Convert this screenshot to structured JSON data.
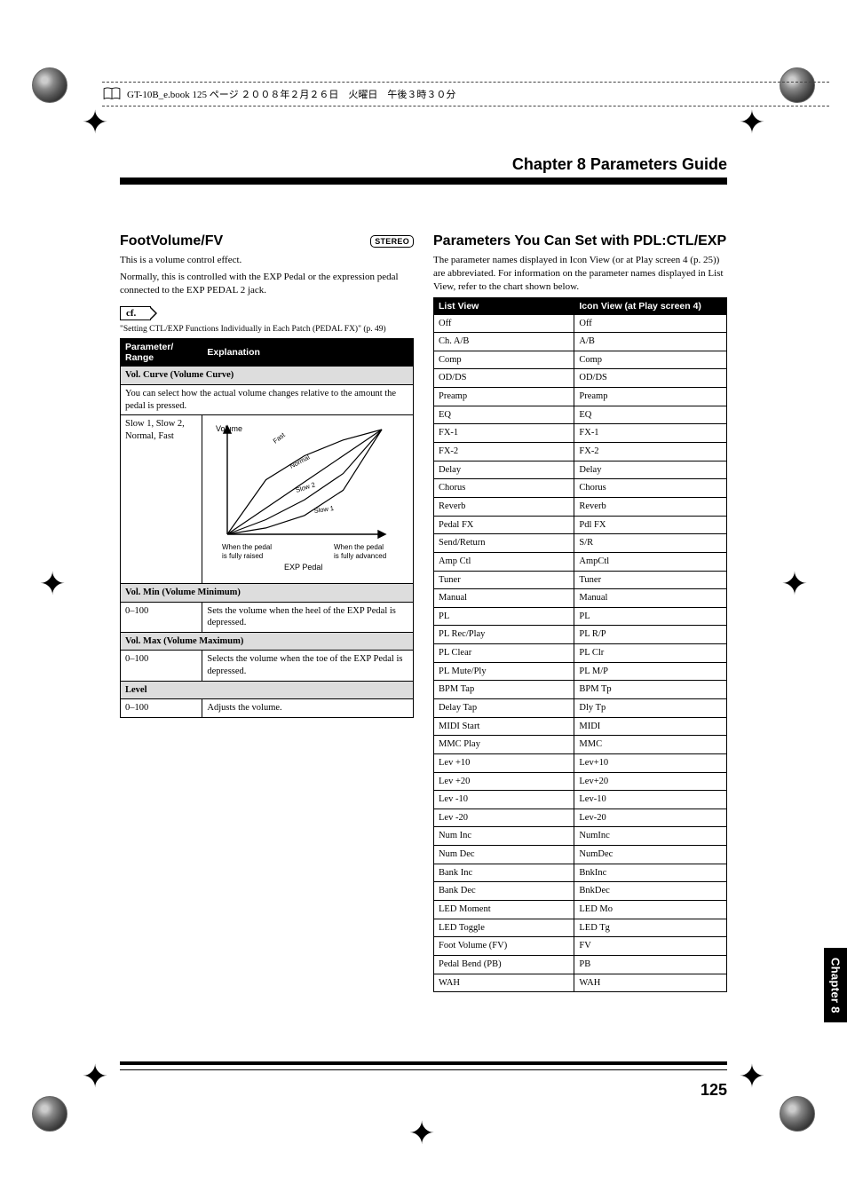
{
  "header_strip": "GT-10B_e.book 125 ページ ２００８年２月２６日　火曜日　午後３時３０分",
  "chapter_title": "Chapter 8 Parameters Guide",
  "side_tab": "Chapter 8",
  "page_number": "125",
  "left": {
    "heading": "FootVolume/FV",
    "stereo": "STEREO",
    "intro": "This is a volume control effect.",
    "body": "Normally, this is controlled with the EXP Pedal or the expression pedal connected to the EXP PEDAL 2 jack.",
    "cf_label": "cf.",
    "cf_text": "\"Setting CTL/EXP Functions Individually in Each Patch (PEDAL FX)\" (p. 49)",
    "table_header1": "Parameter/\nRange",
    "table_header2": "Explanation",
    "sections": {
      "vol_curve": {
        "title": "Vol. Curve (Volume Curve)",
        "note": "You can select how the actual volume changes relative to the amount the pedal is pressed.",
        "range": "Slow 1, Slow 2, Normal, Fast"
      },
      "vol_min": {
        "title": "Vol. Min (Volume Minimum)",
        "range": "0–100",
        "expl": "Sets the volume when the heel of the EXP Pedal is depressed."
      },
      "vol_max": {
        "title": "Vol. Max (Volume Maximum)",
        "range": "0–100",
        "expl": "Selects the volume when the toe of the EXP Pedal is depressed."
      },
      "level": {
        "title": "Level",
        "range": "0–100",
        "expl": "Adjusts the volume."
      }
    }
  },
  "chart_data": {
    "type": "line",
    "title": "",
    "xlabel": "EXP Pedal",
    "ylabel": "Volume",
    "x_axis_left_label": "When the pedal is fully raised",
    "x_axis_right_label": "When the pedal is fully advanced",
    "x": [
      0,
      25,
      50,
      75,
      100
    ],
    "series": [
      {
        "name": "Fast",
        "values": [
          0,
          52,
          75,
          90,
          100
        ]
      },
      {
        "name": "Normal",
        "values": [
          0,
          25,
          50,
          75,
          100
        ]
      },
      {
        "name": "Slow 2",
        "values": [
          0,
          14,
          33,
          58,
          100
        ]
      },
      {
        "name": "Slow 1",
        "values": [
          0,
          6,
          18,
          42,
          100
        ]
      }
    ],
    "xlim": [
      0,
      100
    ],
    "ylim": [
      0,
      100
    ]
  },
  "right": {
    "heading": "Parameters You Can Set with PDL:CTL/EXP",
    "intro": "The parameter names displayed in Icon View (or at Play screen 4 (p. 25)) are abbreviated. For information on the parameter names displayed in List View, refer to the chart shown below.",
    "col1": "List View",
    "col2": "Icon View (at Play screen 4)",
    "rows": [
      [
        "Off",
        "Off"
      ],
      [
        "Ch. A/B",
        "A/B"
      ],
      [
        "Comp",
        "Comp"
      ],
      [
        "OD/DS",
        "OD/DS"
      ],
      [
        "Preamp",
        "Preamp"
      ],
      [
        "EQ",
        "EQ"
      ],
      [
        "FX-1",
        "FX-1"
      ],
      [
        "FX-2",
        "FX-2"
      ],
      [
        "Delay",
        "Delay"
      ],
      [
        "Chorus",
        "Chorus"
      ],
      [
        "Reverb",
        "Reverb"
      ],
      [
        "Pedal FX",
        "Pdl FX"
      ],
      [
        "Send/Return",
        "S/R"
      ],
      [
        "Amp Ctl",
        "AmpCtl"
      ],
      [
        "Tuner",
        "Tuner"
      ],
      [
        "Manual",
        "Manual"
      ],
      [
        "PL",
        "PL"
      ],
      [
        "PL Rec/Play",
        "PL R/P"
      ],
      [
        "PL Clear",
        "PL Clr"
      ],
      [
        "PL Mute/Ply",
        "PL M/P"
      ],
      [
        "BPM Tap",
        "BPM Tp"
      ],
      [
        "Delay Tap",
        "Dly Tp"
      ],
      [
        "MIDI Start",
        "MIDI"
      ],
      [
        "MMC Play",
        "MMC"
      ],
      [
        "Lev +10",
        "Lev+10"
      ],
      [
        "Lev +20",
        "Lev+20"
      ],
      [
        "Lev -10",
        "Lev-10"
      ],
      [
        "Lev -20",
        "Lev-20"
      ],
      [
        "Num Inc",
        "NumInc"
      ],
      [
        "Num Dec",
        "NumDec"
      ],
      [
        "Bank Inc",
        "BnkInc"
      ],
      [
        "Bank Dec",
        "BnkDec"
      ],
      [
        "LED Moment",
        "LED Mo"
      ],
      [
        "LED Toggle",
        "LED Tg"
      ],
      [
        "Foot Volume (FV)",
        "FV"
      ],
      [
        "Pedal Bend (PB)",
        "PB"
      ],
      [
        "WAH",
        "WAH"
      ]
    ]
  }
}
